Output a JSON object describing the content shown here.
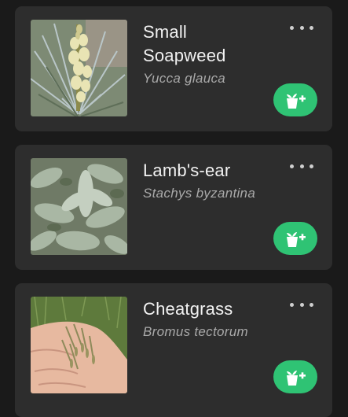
{
  "plants": [
    {
      "common_name": "Small Soapweed",
      "scientific_name": "Yucca glauca",
      "photo_icon": "yucca-photo",
      "menu_icon": "more-horizontal-icon",
      "action_icon": "add-plant-icon"
    },
    {
      "common_name": "Lamb's-ear",
      "scientific_name": "Stachys byzantina",
      "photo_icon": "lambs-ear-photo",
      "menu_icon": "more-horizontal-icon",
      "action_icon": "add-plant-icon"
    },
    {
      "common_name": "Cheatgrass",
      "scientific_name": "Bromus tectorum",
      "photo_icon": "cheatgrass-photo",
      "menu_icon": "more-horizontal-icon",
      "action_icon": "add-plant-icon"
    }
  ],
  "colors": {
    "background": "#1a1a1a",
    "card": "#2d2d2d",
    "accent": "#2fc374",
    "title_text": "#f2f2f2",
    "subtitle_text": "#a9a9a9"
  }
}
